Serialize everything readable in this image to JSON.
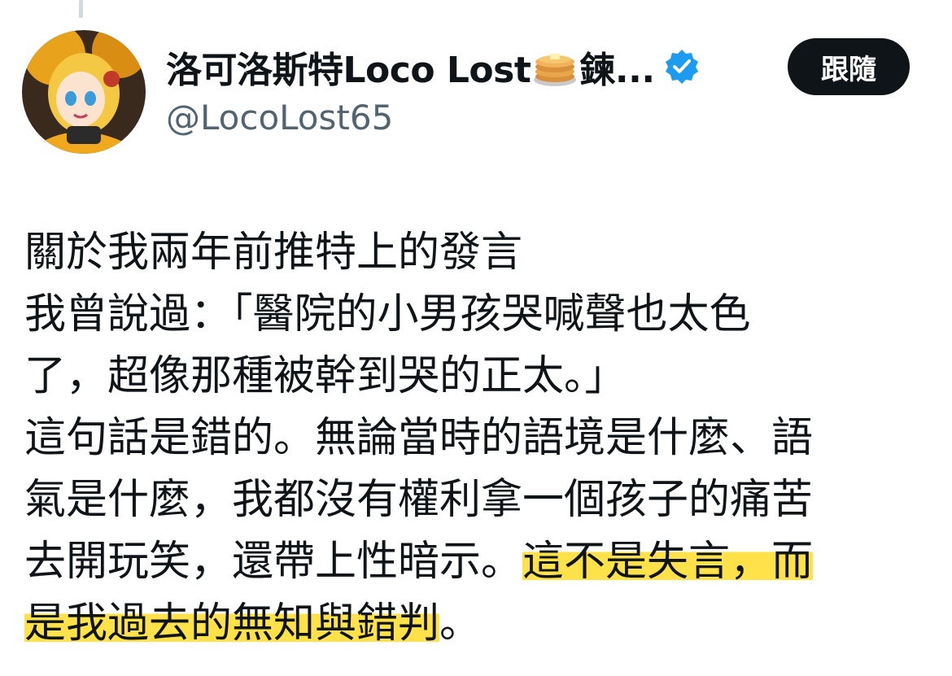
{
  "author": {
    "display_name": "洛可洛斯特Loco Lost",
    "name_suffix": "鍊...",
    "handle": "@LocoLost65",
    "verified": true,
    "emoji_icon": "pancakes-icon"
  },
  "actions": {
    "follow_label": "跟隨"
  },
  "tweet": {
    "lines": [
      {
        "text": "關於我兩年前推特上的發言"
      },
      {
        "text": "我曾說過：「醫院的小男孩哭喊聲也太色"
      },
      {
        "text": "了，超像那種被幹到哭的正太。」"
      },
      {
        "text": "這句話是錯的。無論當時的語境是什麼、語"
      },
      {
        "text": "氣是什麼，我都沒有權利拿一個孩子的痛苦"
      },
      {
        "plain": "去開玩笑，還帶上性暗示。",
        "highlight": "這不是失言，而"
      },
      {
        "highlight": "是我過去的無知與錯判",
        "plain_after": "。"
      }
    ]
  },
  "colors": {
    "text": "#0f1419",
    "secondary_text": "#536471",
    "verified_blue": "#1d9bf0",
    "highlight": "#ffe24a",
    "follow_button_bg": "#0f1419"
  }
}
